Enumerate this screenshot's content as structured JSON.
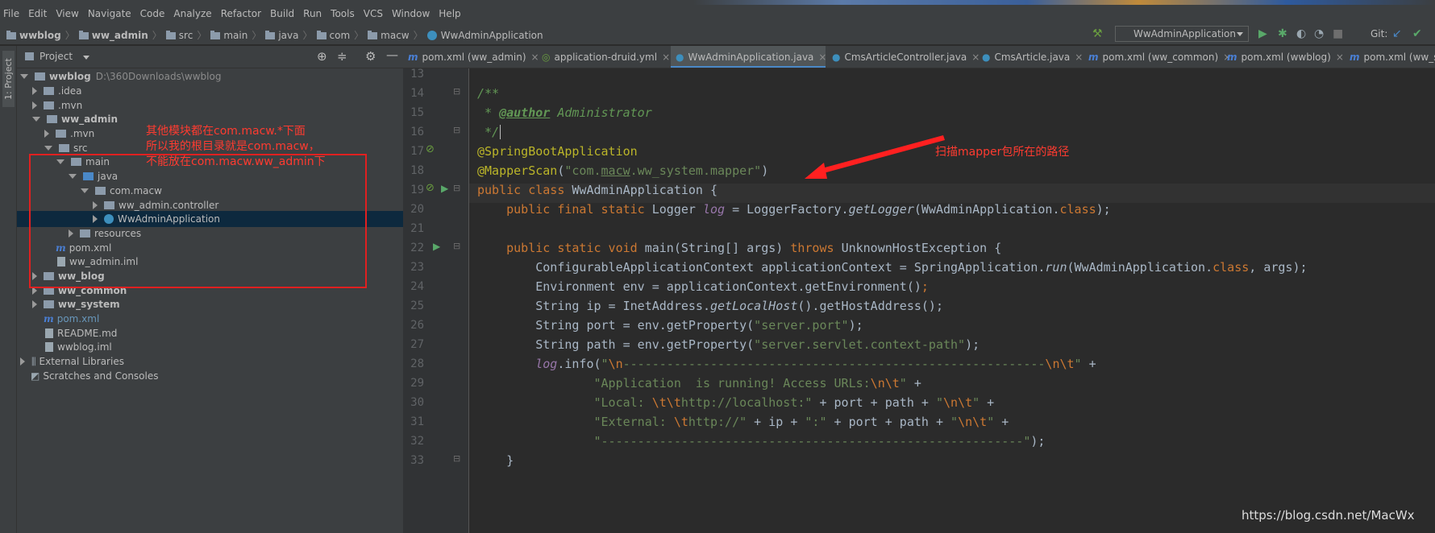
{
  "menu": [
    "File",
    "Edit",
    "View",
    "Navigate",
    "Code",
    "Analyze",
    "Refactor",
    "Build",
    "Run",
    "Tools",
    "VCS",
    "Window",
    "Help"
  ],
  "breadcrumb": [
    "wwblog",
    "ww_admin",
    "src",
    "main",
    "java",
    "com",
    "macw",
    "WwAdminApplication"
  ],
  "toolbar": {
    "run_config": "WwAdminApplication",
    "git_label": "Git:"
  },
  "left_tool": {
    "label": "1: Project"
  },
  "project_panel": {
    "title": "Project"
  },
  "tree": {
    "wwblog": "wwblog",
    "wwblog_path": "D:\\360Downloads\\wwblog",
    "idea": ".idea",
    "mvn": ".mvn",
    "ww_admin": "ww_admin",
    "admin_mvn": ".mvn",
    "src": "src",
    "main": "main",
    "java": "java",
    "com_macw": "com.macw",
    "controller": "ww_admin.controller",
    "app": "WwAdminApplication",
    "resources": "resources",
    "admin_pom": "pom.xml",
    "admin_iml": "ww_admin.iml",
    "ww_blog": "ww_blog",
    "ww_common": "ww_common",
    "ww_system": "ww_system",
    "root_pom": "pom.xml",
    "readme": "README.md",
    "root_iml": "wwblog.iml",
    "ext_libs": "External Libraries",
    "scratches": "Scratches and Consoles"
  },
  "tabs": [
    "pom.xml (ww_admin)",
    "application-druid.yml",
    "WwAdminApplication.java",
    "CmsArticleController.java",
    "CmsArticle.java",
    "pom.xml (ww_common)",
    "pom.xml (wwblog)",
    "pom.xml (ww_s"
  ],
  "line_numbers": [
    "13",
    "14",
    "15",
    "16",
    "17",
    "18",
    "19",
    "20",
    "21",
    "22",
    "23",
    "24",
    "25",
    "26",
    "27",
    "28",
    "29",
    "30",
    "31",
    "32",
    "33"
  ],
  "code": {
    "l14": "/**",
    "l15_a": " * ",
    "l15_tag": "@author",
    "l15_b": " Administrator",
    "l16": " */",
    "l17": "@SpringBootApplication",
    "l18_ann": "@MapperScan",
    "l18_p1": "(",
    "l18_s1": "\"com.",
    "l18_s2": "macw",
    "l18_s3": ".ww_system.mapper\"",
    "l18_p2": ")",
    "l19_kw": "public class ",
    "l19_rest": "WwAdminApplication {",
    "l20_kw": "    public final static ",
    "l20_a": "Logger ",
    "l20_fld": "log",
    "l20_b": " = LoggerFactory.",
    "l20_it": "getLogger",
    "l20_c": "(WwAdminApplication.",
    "l20_kw2": "class",
    "l20_d": ");",
    "l22_kw": "    public static void ",
    "l22_a": "main(String[] args) ",
    "l22_kw2": "throws ",
    "l22_b": "UnknownHostException {",
    "l23_a": "        ConfigurableApplicationContext applicationContext = SpringApplication.",
    "l23_it": "run",
    "l23_b": "(WwAdminApplication.",
    "l23_kw": "class",
    "l23_c": ", args);",
    "l24_a": "        Environment env = applicationContext.getEnvironment()",
    "l24_kw": ";",
    "l25_a": "        String ip = InetAddress.",
    "l25_it": "getLocalHost",
    "l25_b": "().getHostAddress();",
    "l26_a": "        String port = env.getProperty(",
    "l26_s": "\"server.port\"",
    "l26_b": ");",
    "l27_a": "        String path = env.getProperty(",
    "l27_s": "\"server.servlet.context-path\"",
    "l27_b": ");",
    "l28_a": "        ",
    "l28_fld": "log",
    "l28_b": ".info(",
    "l28_s1": "\"",
    "l28_e1": "\\n",
    "l28_s2": "----------------------------------------------------------",
    "l28_e2": "\\n\\t",
    "l28_s3": "\"",
    "l28_c": " +",
    "l29_a": "                ",
    "l29_s1": "\"Application  is running! Access URLs:",
    "l29_e": "\\n\\t",
    "l29_s2": "\"",
    "l29_b": " +",
    "l30_a": "                ",
    "l30_s1": "\"Local: ",
    "l30_e1": "\\t\\t",
    "l30_s2": "http://localhost:\"",
    "l30_b": " + port + path + ",
    "l30_s3": "\"",
    "l30_e2": "\\n\\t",
    "l30_s4": "\"",
    "l30_c": " +",
    "l31_a": "                ",
    "l31_s1": "\"External: ",
    "l31_e1": "\\t",
    "l31_s2": "http://\"",
    "l31_b": " + ip + ",
    "l31_s3": "\":\"",
    "l31_c": " + port + path + ",
    "l31_s4": "\"",
    "l31_e2": "\\n\\t",
    "l31_s5": "\"",
    "l31_d": " +",
    "l32_a": "                ",
    "l32_s": "\"----------------------------------------------------------\"",
    "l32_b": ");",
    "l33": "    }"
  },
  "annotations": {
    "note_left_1": "其他模块都在com.macw.*下面",
    "note_left_2": "所以我的根目录就是com.macw，",
    "note_left_3": "不能放在com.macw.ww_admin下",
    "note_right": "扫描mapper包所在的路径"
  },
  "watermark": "https://blog.csdn.net/MacWx",
  "colors": {
    "accent": "#4a88c7",
    "annotation_red": "#ff3b30",
    "selection": "#0d293e"
  }
}
